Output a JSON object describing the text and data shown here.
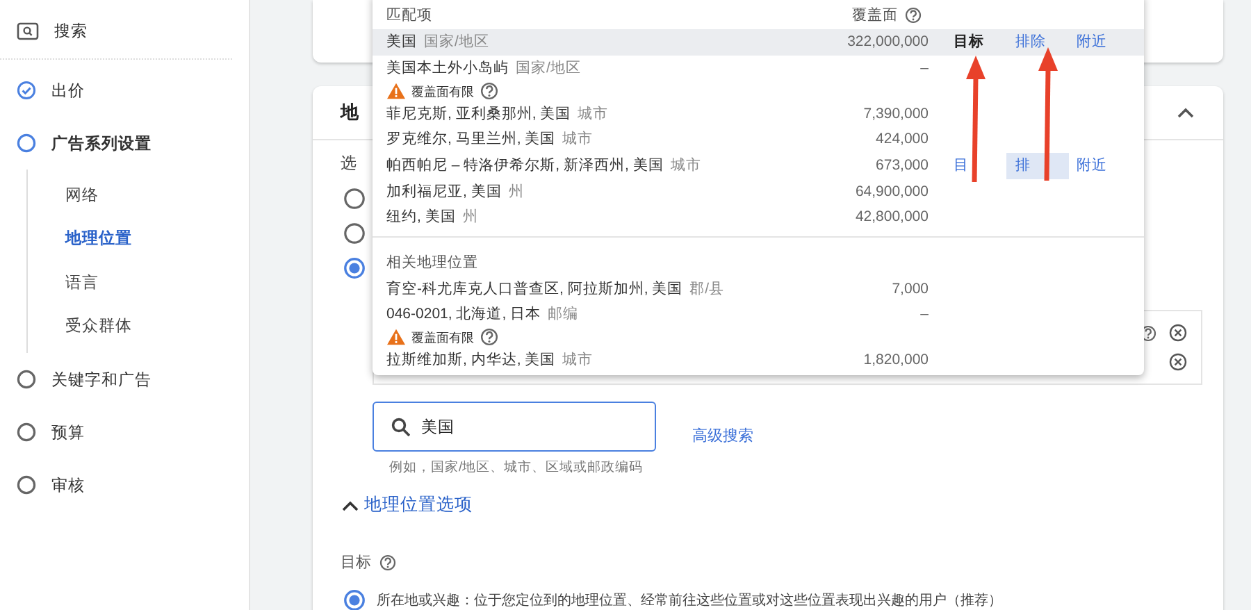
{
  "sidebar": {
    "items": [
      {
        "kind": "search",
        "label": "搜索"
      },
      {
        "kind": "step",
        "label": "出价",
        "completed": true,
        "current": false
      },
      {
        "kind": "step",
        "label": "广告系列设置",
        "completed": false,
        "current": true,
        "children": [
          {
            "label": "网络",
            "selected": false
          },
          {
            "label": "地理位置",
            "selected": true
          },
          {
            "label": "语言",
            "selected": false
          },
          {
            "label": "受众群体",
            "selected": false
          }
        ]
      },
      {
        "kind": "step",
        "label": "关键字和广告",
        "completed": false,
        "current": false
      },
      {
        "kind": "step",
        "label": "预算",
        "completed": false,
        "current": false
      },
      {
        "kind": "step",
        "label": "审核",
        "completed": false,
        "current": false
      }
    ]
  },
  "location_card": {
    "title": "地",
    "prompt": "选",
    "expanded": true,
    "radios": [
      {
        "selected": false
      },
      {
        "selected": false
      },
      {
        "selected": true
      }
    ],
    "search": {
      "value": "美国",
      "hint": "例如，国家/地区、城市、区域或邮政编码"
    },
    "advanced_link": "高级搜索",
    "options": {
      "label": "地理位置选项",
      "expanded": true,
      "target_label": "目标",
      "choices": [
        {
          "label": "所在地或兴趣：位于您定位到的地理位置、经常前往这些位置或对这些位置表现出兴趣的用户（推荐）",
          "selected": true
        }
      ]
    }
  },
  "dropdown": {
    "match_header": "匹配项",
    "coverage_header": "覆盖面",
    "matches": [
      {
        "name": "美国",
        "type": "国家/地区",
        "coverage": "322,000,000",
        "highlighted": true,
        "actions": [
          {
            "label": "目标",
            "pressed": true,
            "hovered": false
          },
          {
            "label": "排除",
            "pressed": false,
            "hovered": false
          },
          {
            "label": "附近",
            "pressed": false,
            "hovered": false
          }
        ]
      },
      {
        "name": "美国本土外小岛屿",
        "type": "国家/地区",
        "coverage": "–",
        "highlighted": false,
        "warning": "覆盖面有限"
      },
      {
        "name": "菲尼克斯, 亚利桑那州, 美国",
        "type": "城市",
        "coverage": "7,390,000",
        "highlighted": false
      },
      {
        "name": "罗克维尔, 马里兰州, 美国",
        "type": "城市",
        "coverage": "424,000",
        "highlighted": false
      },
      {
        "name": "帕西帕尼 – 特洛伊希尔斯, 新泽西州, 美国",
        "type": "城市",
        "coverage": "673,000",
        "highlighted": false,
        "actions": [
          {
            "label": "目",
            "pressed": false,
            "hovered": false
          },
          {
            "label": "排",
            "pressed": false,
            "hovered": true
          },
          {
            "label": "附近",
            "pressed": false,
            "hovered": false
          }
        ]
      },
      {
        "name": "加利福尼亚, 美国",
        "type": "州",
        "coverage": "64,900,000",
        "highlighted": false
      },
      {
        "name": "纽约, 美国",
        "type": "州",
        "coverage": "42,800,000",
        "highlighted": false
      }
    ],
    "related_header": "相关地理位置",
    "related": [
      {
        "name": "育空-科尤库克人口普查区, 阿拉斯加州, 美国",
        "type": "郡/县",
        "coverage": "7,000",
        "highlighted": false
      },
      {
        "name": "046-0201, 北海道, 日本",
        "type": "邮编",
        "coverage": "–",
        "highlighted": false,
        "warning": "覆盖面有限"
      },
      {
        "name": "拉斯维加斯, 内华达, 美国",
        "type": "城市",
        "coverage": "1,820,000",
        "highlighted": false
      }
    ]
  }
}
